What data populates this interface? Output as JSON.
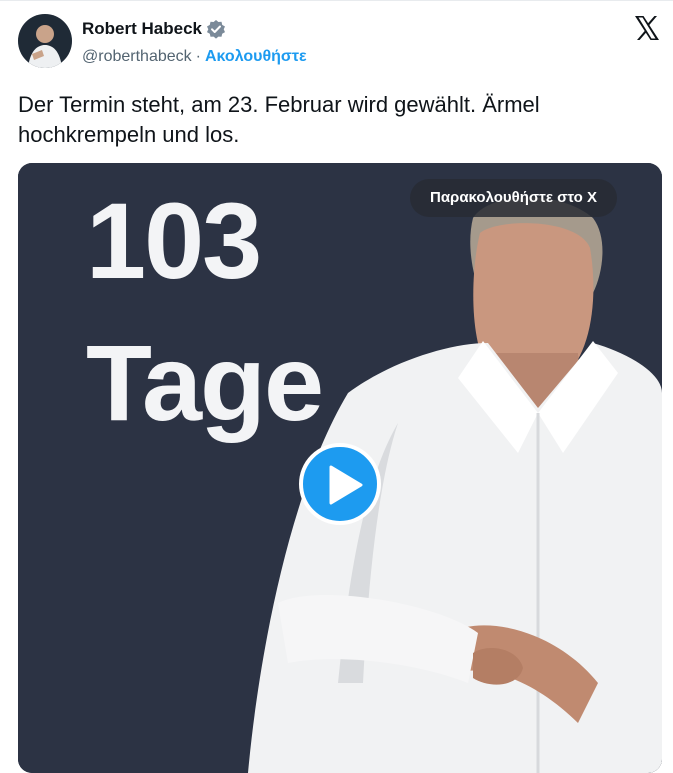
{
  "author": {
    "name": "Robert Habeck",
    "handle": "@roberthabeck",
    "separator": "·",
    "follow_label": "Ακολουθήστε"
  },
  "tweet": {
    "text": "Der Termin steht, am 23. Februar wird gewählt. Ärmel\nhochkrempeln und los."
  },
  "media": {
    "overlay_line1": "103",
    "overlay_line2": "Tage",
    "watch_label": "Παρακολουθήστε στο X",
    "play_icon": "play-icon"
  },
  "colors": {
    "accent": "#1d9bf0",
    "video_bg": "#2c3344",
    "text": "#0f1419",
    "muted": "#536471"
  }
}
